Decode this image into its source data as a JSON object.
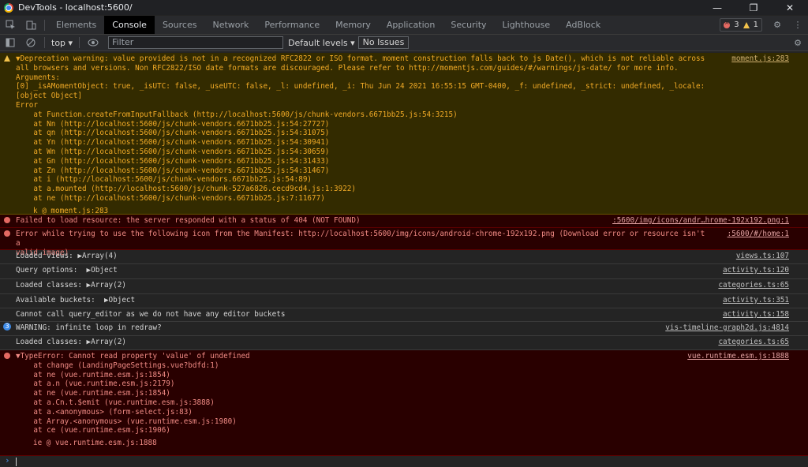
{
  "window": {
    "title": "DevTools - localhost:5600/"
  },
  "tabs": [
    "Elements",
    "Console",
    "Sources",
    "Network",
    "Performance",
    "Memory",
    "Application",
    "Security",
    "Lighthouse",
    "AdBlock"
  ],
  "badges": {
    "errors": "3",
    "warnings": "1"
  },
  "toolbar": {
    "context": "top",
    "filter_placeholder": "Filter",
    "levels": "Default levels",
    "issues": "No Issues"
  },
  "messages": [
    {
      "type": "warn",
      "src": "moment.js:283",
      "lines": [
        "▼Deprecation warning: value provided is not in a recognized RFC2822 or ISO format. moment construction falls back to js Date(), which is not reliable across",
        "all browsers and versions. Non RFC2822/ISO date formats are discouraged. Please refer to http://momentjs.com/guides/#/warnings/js-date/ for more info.",
        "Arguments:",
        "[0] _isAMomentObject: true, _isUTC: false, _useUTC: false, _l: undefined, _i: Thu Jun 24 2021 16:55:15 GMT-0400, _f: undefined, _strict: undefined, _locale: [object Object]",
        "Error",
        "    at Function.createFromInputFallback (http://localhost:5600/js/chunk-vendors.6671bb25.js:54:3215)",
        "    at Nn (http://localhost:5600/js/chunk-vendors.6671bb25.js:54:27727)",
        "    at qn (http://localhost:5600/js/chunk-vendors.6671bb25.js:54:31075)",
        "    at Yn (http://localhost:5600/js/chunk-vendors.6671bb25.js:54:30941)",
        "    at Wn (http://localhost:5600/js/chunk-vendors.6671bb25.js:54:30659)",
        "    at Gn (http://localhost:5600/js/chunk-vendors.6671bb25.js:54:31433)",
        "    at Zn (http://localhost:5600/js/chunk-vendors.6671bb25.js:54:31467)",
        "    at i (http://localhost:5600/js/chunk-vendors.6671bb25.js:54:89)",
        "    at a.mounted (http://localhost:5600/js/chunk-527a6826.cecd9cd4.js:1:3922)",
        "    at ne (http://localhost:5600/js/chunk-vendors.6671bb25.js:7:11677)"
      ],
      "trace": "k @ moment.js:283"
    },
    {
      "type": "err",
      "src": ":5600/img/icons/andr…hrome-192x192.png:1",
      "lines": [
        "Failed to load resource: the server responded with a status of 404 (NOT FOUND)"
      ]
    },
    {
      "type": "err",
      "src": ":5600/#/home:1",
      "lines": [
        "Error while trying to use the following icon from the Manifest: http://localhost:5600/img/icons/android-chrome-192x192.png (Download error or resource isn't a",
        "valid image)"
      ]
    },
    {
      "type": "log",
      "src": "views.ts:107",
      "lines": [
        "Loaded views: ▶Array(4)"
      ]
    },
    {
      "type": "log",
      "src": "activity.ts:120",
      "lines": [
        "Query options:  ▶Object"
      ]
    },
    {
      "type": "log",
      "src": "categories.ts:65",
      "lines": [
        "Loaded classes: ▶Array(2)"
      ]
    },
    {
      "type": "log",
      "src": "activity.ts:351",
      "lines": [
        "Available buckets:  ▶Object"
      ]
    },
    {
      "type": "log",
      "src": "activity.ts:158",
      "lines": [
        "Cannot call query_editor as we do not have any editor buckets"
      ]
    },
    {
      "type": "log",
      "count": "3",
      "src": "vis-timeline-graph2d.js:4814",
      "lines": [
        "WARNING: infinite loop in redraw?"
      ]
    },
    {
      "type": "log",
      "src": "categories.ts:65",
      "lines": [
        "Loaded classes: ▶Array(2)"
      ]
    },
    {
      "type": "err",
      "src": "vue.runtime.esm.js:1888",
      "lines": [
        "▼TypeError: Cannot read property 'value' of undefined",
        "    at change (LandingPageSettings.vue?bdfd:1)",
        "    at ne (vue.runtime.esm.js:1854)",
        "    at a.n (vue.runtime.esm.js:2179)",
        "    at ne (vue.runtime.esm.js:1854)",
        "    at a.Cn.t.$emit (vue.runtime.esm.js:3888)",
        "    at a.<anonymous> (form-select.js:83)",
        "    at Array.<anonymous> (vue.runtime.esm.js:1980)",
        "    at ce (vue.runtime.esm.js:1906)"
      ],
      "trace": "ie @ vue.runtime.esm.js:1888"
    }
  ],
  "prompt": {
    "symbol": "›"
  }
}
